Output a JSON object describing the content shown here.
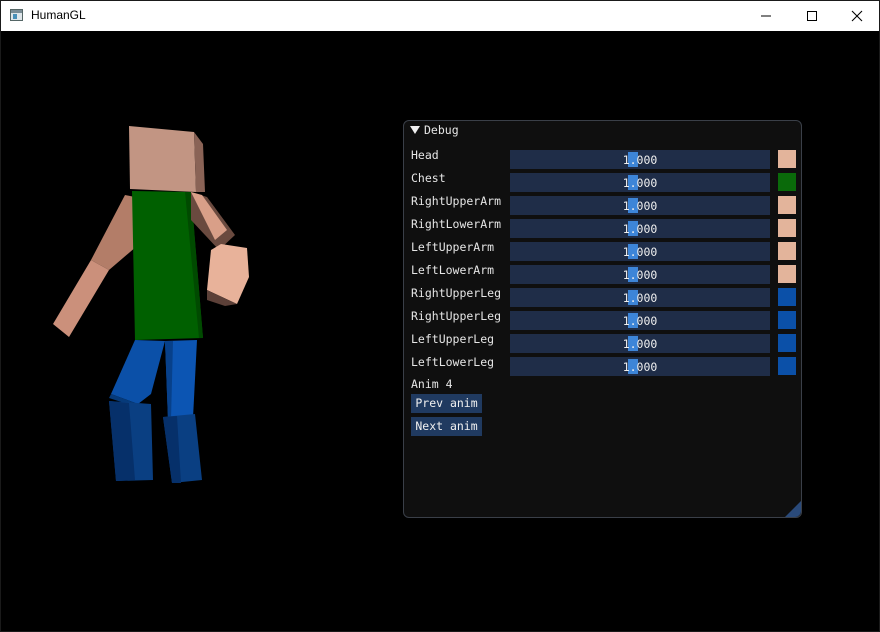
{
  "window": {
    "title": "HumanGL",
    "icons": {
      "app": "app-window-icon",
      "minimize": "minimize-icon",
      "maximize": "maximize-icon",
      "close": "close-icon"
    }
  },
  "panel": {
    "title": "Debug",
    "collapse_icon": "triangle-down-icon",
    "rows": [
      {
        "label": "Head",
        "value": "1.000",
        "color": "#e3b49b"
      },
      {
        "label": "Chest",
        "value": "1.000",
        "color": "#0a6a0a"
      },
      {
        "label": "RightUpperArm",
        "value": "1.000",
        "color": "#e3b49b"
      },
      {
        "label": "RightLowerArm",
        "value": "1.000",
        "color": "#e3b49b"
      },
      {
        "label": "LeftUpperArm",
        "value": "1.000",
        "color": "#e3b49b"
      },
      {
        "label": "LeftLowerArm",
        "value": "1.000",
        "color": "#e3b49b"
      },
      {
        "label": "RightUpperLeg",
        "value": "1.000",
        "color": "#0b50a8"
      },
      {
        "label": "RightUpperLeg",
        "value": "1.000",
        "color": "#0b50a8"
      },
      {
        "label": "LeftUpperLeg",
        "value": "1.000",
        "color": "#0b50a8"
      },
      {
        "label": "LeftLowerLeg",
        "value": "1.000",
        "color": "#0b50a8"
      }
    ],
    "anim_label": "Anim 4",
    "prev_button": "Prev anim",
    "next_button": "Next anim"
  },
  "colors": {
    "skin": "#e3b49b",
    "shirt": "#0a6a0a",
    "pants": "#0b50a8",
    "slider_bg": "#1f2d48",
    "slider_grab": "#3d85d8",
    "button_bg": "#203a60"
  }
}
